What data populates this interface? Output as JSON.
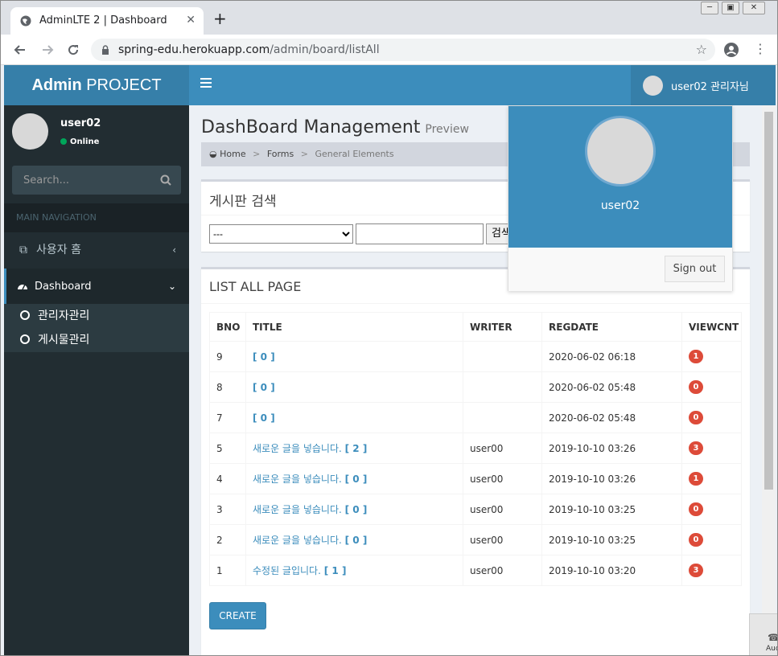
{
  "browser": {
    "tab_title": "AdminLTE 2 | Dashboard",
    "tab_close": "✕",
    "new_tab": "+",
    "url_host": "spring-edu.herokuapp.com",
    "url_path": "/admin/board/listAll"
  },
  "header": {
    "logo_bold": "Admin",
    "logo_rest": " PROJECT",
    "user_label": "user02 관리자님"
  },
  "sidebar": {
    "user_name": "user02",
    "status": "Online",
    "search_placeholder": "Search...",
    "nav_header": "MAIN NAVIGATION",
    "items": [
      {
        "label": "사용자 홈",
        "arrow": "‹"
      },
      {
        "label": "Dashboard",
        "arrow": "⌄"
      }
    ],
    "subitems": [
      {
        "label": "관리자관리"
      },
      {
        "label": "게시물관리"
      }
    ]
  },
  "content": {
    "title": "DashBoard Management",
    "subtitle": "Preview",
    "breadcrumb": [
      "Home",
      "Forms",
      "General Elements"
    ],
    "breadcrumb_sep": ">"
  },
  "search_box": {
    "title": "게시판 검색",
    "select_value": "---",
    "keyword_value": "",
    "button_label": "검색"
  },
  "list_box": {
    "title": "LIST ALL PAGE",
    "columns": [
      "BNO",
      "TITLE",
      "WRITER",
      "REGDATE",
      "VIEWCNT"
    ],
    "rows": [
      {
        "bno": "9",
        "title": "",
        "reply": "[ 0 ]",
        "writer": "",
        "regdate": "2020-06-02 06:18",
        "viewcnt": "1"
      },
      {
        "bno": "8",
        "title": "",
        "reply": "[ 0 ]",
        "writer": "",
        "regdate": "2020-06-02 05:48",
        "viewcnt": "0"
      },
      {
        "bno": "7",
        "title": "",
        "reply": "[ 0 ]",
        "writer": "",
        "regdate": "2020-06-02 05:48",
        "viewcnt": "0"
      },
      {
        "bno": "5",
        "title": "새로운 글을 넣습니다.",
        "reply": "[ 2 ]",
        "writer": "user00",
        "regdate": "2019-10-10 03:26",
        "viewcnt": "3"
      },
      {
        "bno": "4",
        "title": "새로운 글을 넣습니다.",
        "reply": "[ 0 ]",
        "writer": "user00",
        "regdate": "2019-10-10 03:26",
        "viewcnt": "1"
      },
      {
        "bno": "3",
        "title": "새로운 글을 넣습니다.",
        "reply": "[ 0 ]",
        "writer": "user00",
        "regdate": "2019-10-10 03:25",
        "viewcnt": "0"
      },
      {
        "bno": "2",
        "title": "새로운 글을 넣습니다.",
        "reply": "[ 0 ]",
        "writer": "user00",
        "regdate": "2019-10-10 03:25",
        "viewcnt": "0"
      },
      {
        "bno": "1",
        "title": "수정된 글입니다.",
        "reply": "[ 1 ]",
        "writer": "user00",
        "regdate": "2019-10-10 03:20",
        "viewcnt": "3"
      }
    ],
    "create_label": "CREATE"
  },
  "user_dropdown": {
    "name": "user02",
    "signout_label": "Sign out"
  },
  "audio_widget": {
    "label": "Aud"
  },
  "colors": {
    "primary": "#3c8dbc",
    "primary_dark": "#367fa9",
    "sidebar_bg": "#222d32",
    "badge_red": "#dd4b39",
    "online_green": "#00a65a"
  }
}
